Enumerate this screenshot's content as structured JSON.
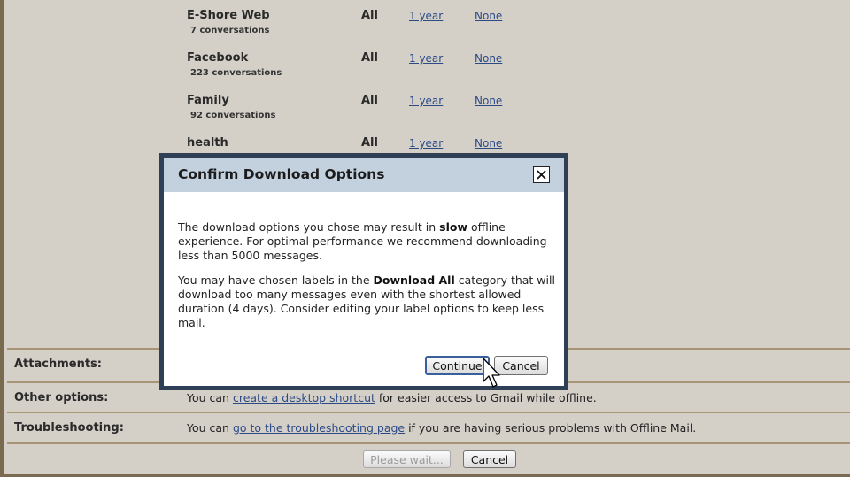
{
  "labels": [
    {
      "name": "E-Shore Web",
      "count": "7 conversations",
      "scope": "All",
      "duration": "1 year",
      "none": "None"
    },
    {
      "name": "Facebook",
      "count": "223 conversations",
      "scope": "All",
      "duration": "1 year",
      "none": "None"
    },
    {
      "name": "Family",
      "count": "92 conversations",
      "scope": "All",
      "duration": "1 year",
      "none": "None"
    },
    {
      "name": "health",
      "count": "",
      "scope": "All",
      "duration": "1 year",
      "none": "None"
    }
  ],
  "options": {
    "attachments": {
      "label": "Attachments:"
    },
    "other": {
      "label": "Other options:",
      "pre": "You can ",
      "link": "create a desktop shortcut",
      "post": " for easier access to Gmail while offline."
    },
    "troubleshooting": {
      "label": "Troubleshooting:",
      "pre": "You can ",
      "link": "go to the troubleshooting page",
      "post": " if you are having serious problems with Offline Mail."
    }
  },
  "footer": {
    "wait_label": "Please wait...",
    "cancel_label": "Cancel"
  },
  "dialog": {
    "title": "Confirm Download Options",
    "close_icon": "close-icon",
    "p1_a": "The download options you chose may result in ",
    "p1_bold": "slow",
    "p1_b": " offline experience. For optimal performance we recommend downloading less than 5000 messages.",
    "p2_a": "You may have chosen labels in the ",
    "p2_bold": "Download All",
    "p2_b": " category that will download too many messages even with the shortest allowed duration (4 days). Consider editing your label options to keep less mail.",
    "continue_label": "Continue",
    "cancel_label": "Cancel"
  },
  "colors": {
    "background": "#d4d0c8",
    "dialog_frame": "#2f3f55",
    "dialog_header": "#c3d1df",
    "link": "#2b4a86",
    "divider": "#a89576"
  }
}
